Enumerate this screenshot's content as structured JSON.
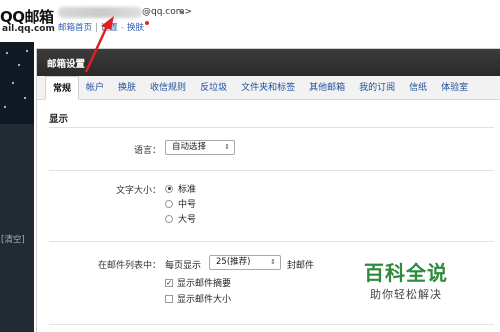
{
  "header": {
    "logo_main": "QQ邮箱",
    "logo_sub": "ail.qq.com",
    "email_suffix": "@qq.com>",
    "dropdown": "▾",
    "links": {
      "home": "邮箱首页",
      "settings": "设置",
      "skin": "换肤"
    },
    "separator": "|",
    "separator2": "-"
  },
  "sidebar": {
    "clear_label": "[清空]"
  },
  "window": {
    "title": "邮箱设置",
    "tabs": [
      "常规",
      "帐户",
      "换肤",
      "收信规则",
      "反垃圾",
      "文件夹和标签",
      "其他邮箱",
      "我的订阅",
      "信纸",
      "体验室"
    ],
    "section_title": "显示",
    "language": {
      "label": "语言：",
      "value": "自动选择"
    },
    "font_size": {
      "label": "文字大小：",
      "options": [
        "标准",
        "中号",
        "大号"
      ],
      "selected": "标准"
    },
    "list": {
      "label": "在邮件列表中：",
      "prefix": "每页显示",
      "value": "25(推荐)",
      "suffix": "封邮件",
      "show_summary": "显示邮件摘要",
      "show_size": "显示邮件大小"
    }
  },
  "watermark": {
    "title": "百科全说",
    "subtitle": "助你轻松解决"
  },
  "colors": {
    "accent_link": "#2a5db0",
    "header_dark": "#2a2a2a",
    "annotation_red": "#e02020",
    "watermark_green": "#2e8b3e"
  }
}
